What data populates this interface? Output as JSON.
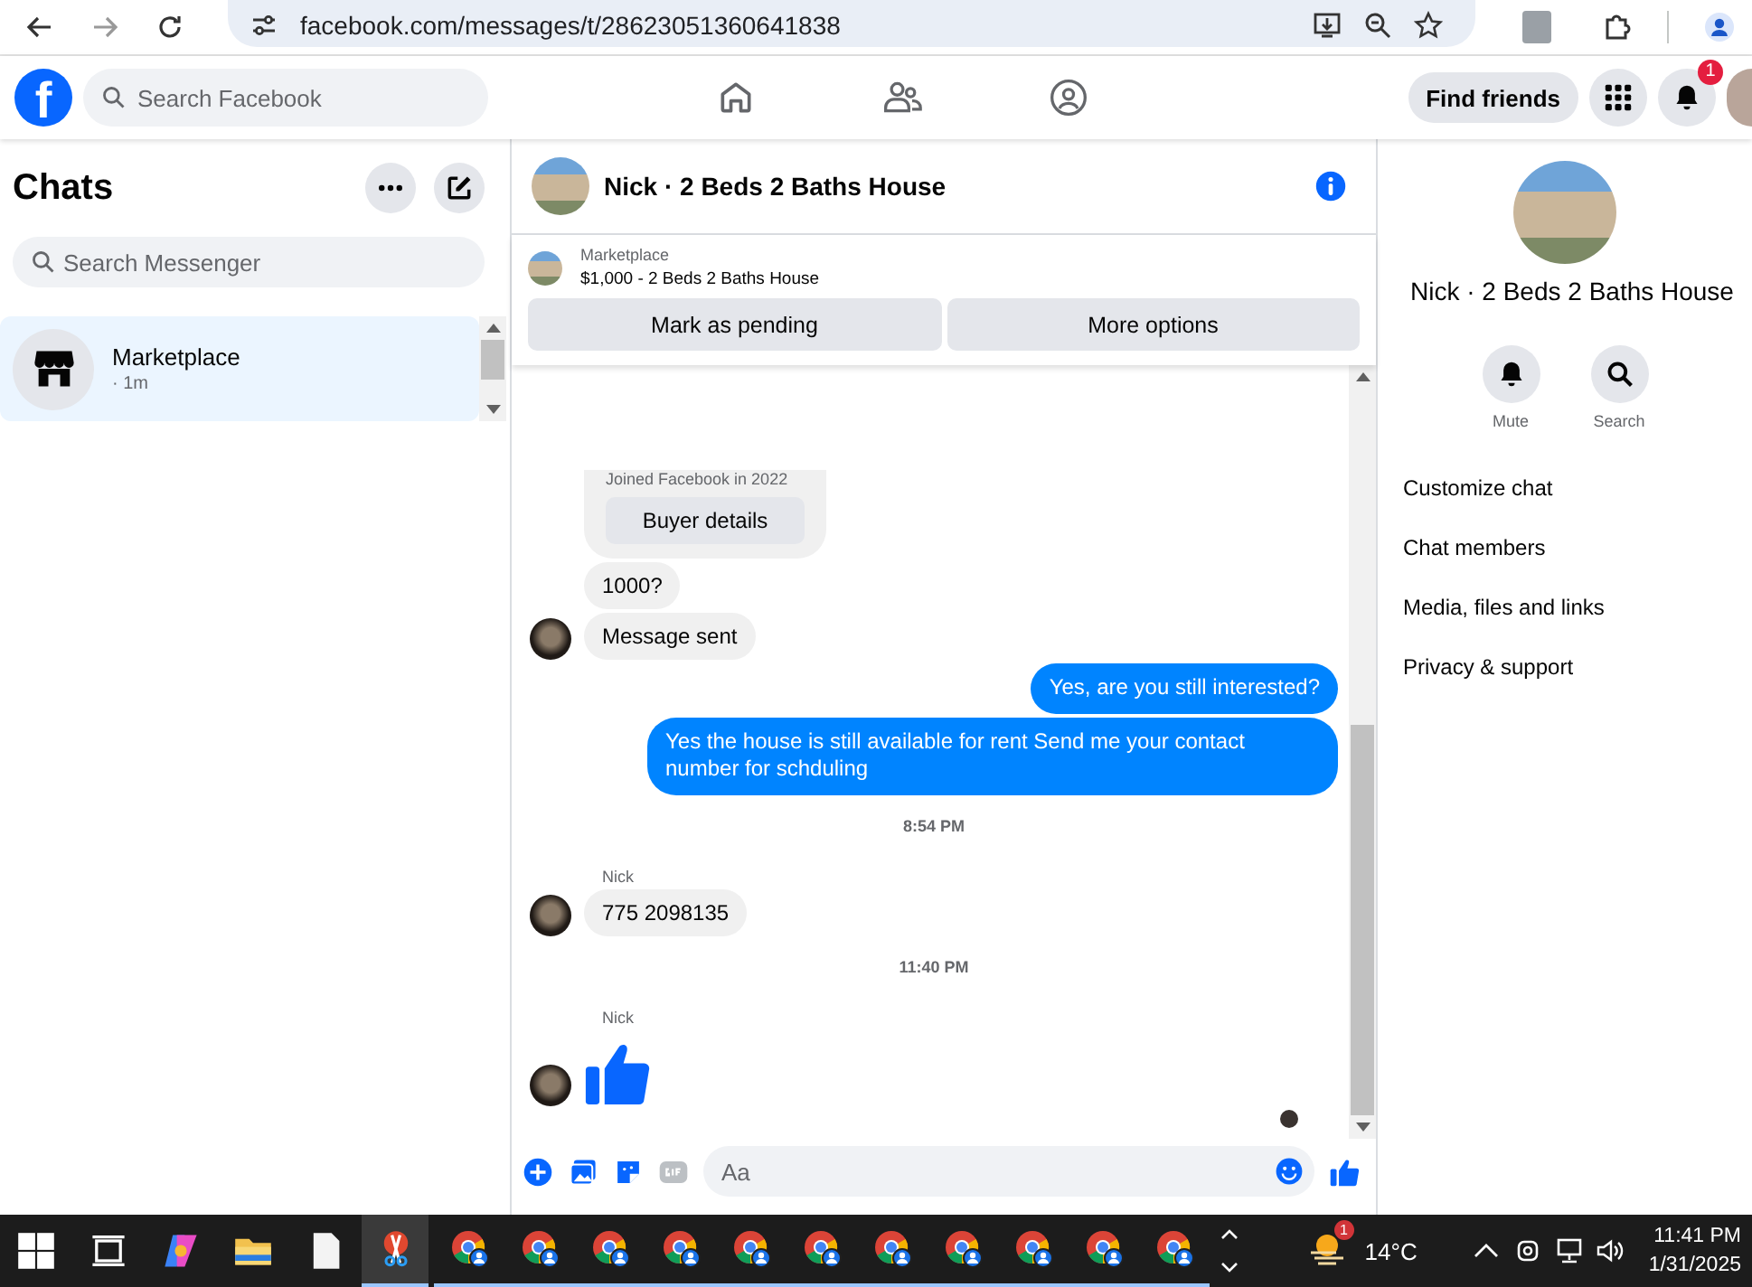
{
  "browser": {
    "url": "facebook.com/messages/t/28623051360641838"
  },
  "header": {
    "logo": "f",
    "search_placeholder": "Search Facebook",
    "find_friends": "Find friends",
    "notification_count": "1"
  },
  "chats": {
    "title": "Chats",
    "search_placeholder": "Search Messenger",
    "items": [
      {
        "name": "Marketplace",
        "time": "· 1m",
        "selected": true
      }
    ]
  },
  "conversation": {
    "title": "Nick · 2 Beds 2 Baths House",
    "listing": {
      "label": "Marketplace",
      "title": "$1,000 - 2 Beds 2 Baths House"
    },
    "buttons": [
      "Mark as pending",
      "More options"
    ],
    "messages": [
      {
        "kind": "card",
        "note": "Joined Facebook in 2022",
        "button": "Buyer details"
      },
      {
        "kind": "in",
        "text": "1000?",
        "avatar": false
      },
      {
        "kind": "in",
        "text": "Message sent",
        "avatar": true
      },
      {
        "kind": "out",
        "text": "Yes, are you still interested?"
      },
      {
        "kind": "out",
        "text": "Yes the house is still available for rent Send me your contact number for schduling"
      },
      {
        "kind": "time",
        "text": "8:54 PM"
      },
      {
        "kind": "sender",
        "text": "Nick"
      },
      {
        "kind": "in",
        "text": "775 2098135",
        "avatar": true
      },
      {
        "kind": "time",
        "text": "11:40 PM"
      },
      {
        "kind": "sender",
        "text": "Nick"
      },
      {
        "kind": "like",
        "avatar": true
      }
    ],
    "composer_placeholder": "Aa"
  },
  "details": {
    "name": "Nick · 2 Beds 2 Baths House",
    "actions": [
      {
        "kind": "mute",
        "label": "Mute"
      },
      {
        "kind": "search",
        "label": "Search"
      }
    ],
    "menu": [
      "Customize chat",
      "Chat members",
      "Media, files and links",
      "Privacy & support"
    ]
  },
  "taskbar": {
    "weather_badge": "1",
    "temperature": "14°C",
    "time": "11:41 PM",
    "date": "1/31/2025"
  }
}
